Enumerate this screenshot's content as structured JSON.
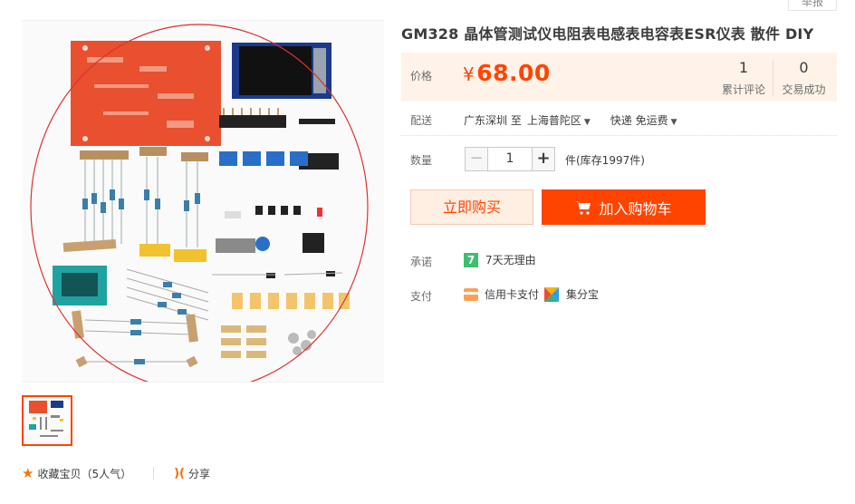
{
  "header": {
    "report_label": "举报"
  },
  "product": {
    "title": "GM328 晶体管测试仪电阻表电感表电容表ESR仪表 散件 DIY",
    "price_label": "价格",
    "currency": "¥",
    "price": "68.00",
    "reviews_count": "1",
    "reviews_label": "累计评论",
    "sold_count": "0",
    "sold_label": "交易成功"
  },
  "delivery": {
    "label": "配送",
    "from": "广东深圳 至",
    "to": "上海普陀区",
    "method": "快递 免运费"
  },
  "quantity": {
    "label": "数量",
    "minus": "−",
    "value": "1",
    "plus": "+",
    "stock_text": "件(库存1997件)"
  },
  "actions": {
    "buy_now": "立即购买",
    "add_to_cart": "加入购物车"
  },
  "promise": {
    "label": "承诺",
    "badge": "7",
    "text": "7天无理由"
  },
  "payment": {
    "label": "支付",
    "credit_card": "信用卡支付",
    "jifenbao": "集分宝"
  },
  "gallery": {
    "favorite": "收藏宝贝（5人气）",
    "share": "分享"
  },
  "colors": {
    "accent": "#ff4400",
    "price": "#ff4400",
    "price_bg": "#fff2e8",
    "highlight_circle": "#e03030"
  }
}
